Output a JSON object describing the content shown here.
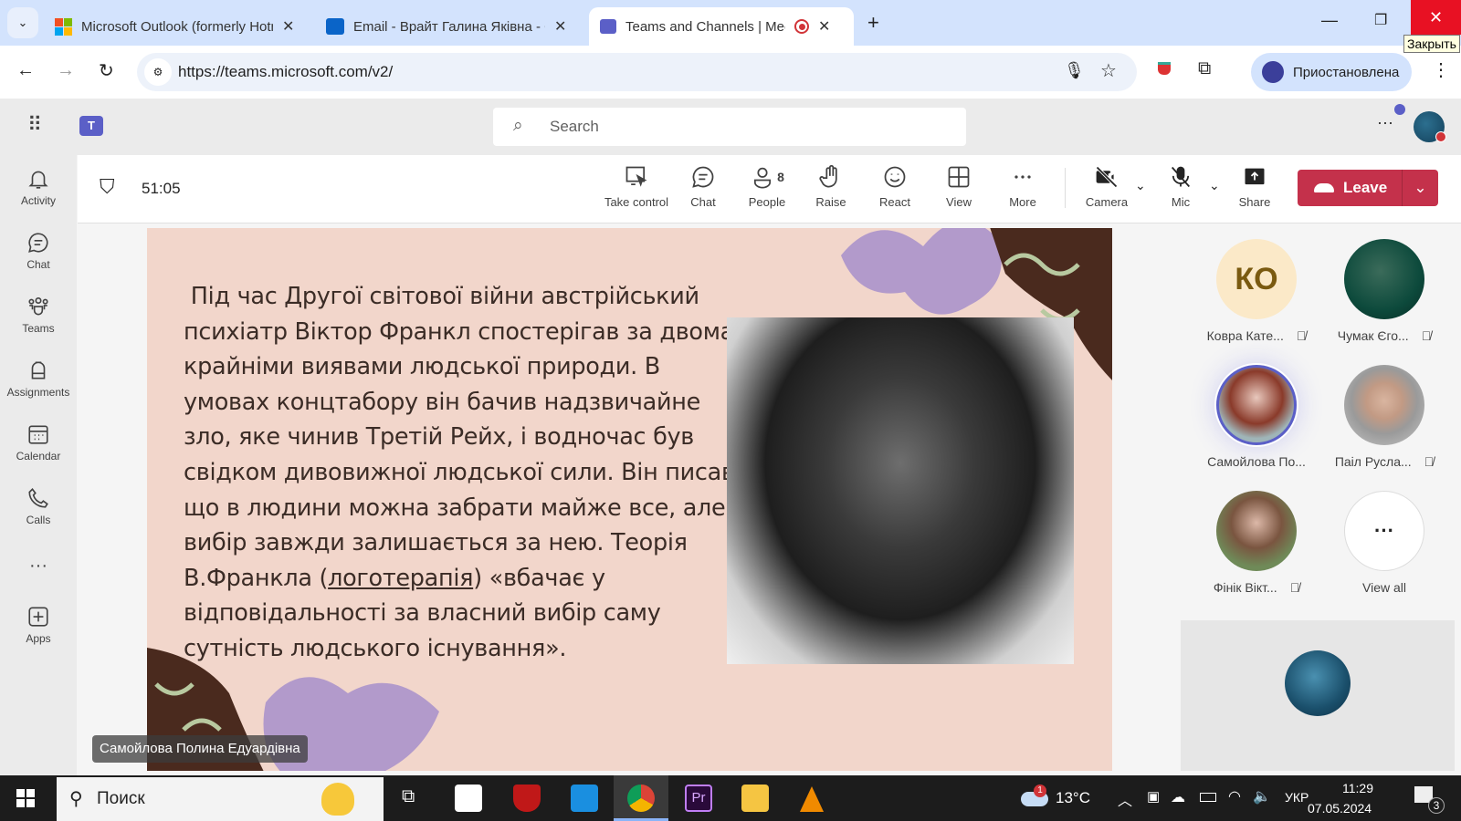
{
  "browser": {
    "tabs": [
      {
        "title": "Microsoft Outlook (formerly Hotmail)",
        "active": false
      },
      {
        "title": "Email - Врайт Галина Яківна - Outlook",
        "active": false
      },
      {
        "title": "Teams and Channels | Meeting",
        "active": true
      }
    ],
    "url": "https://teams.microsoft.com/v2/",
    "profile_label": "Приостановлена",
    "close_tooltip": "Закрыть"
  },
  "teams": {
    "search_placeholder": "Search",
    "rail": [
      {
        "label": "Activity",
        "icon": "bell-icon"
      },
      {
        "label": "Chat",
        "icon": "chat-icon"
      },
      {
        "label": "Teams",
        "icon": "teams-icon"
      },
      {
        "label": "Assignments",
        "icon": "backpack-icon"
      },
      {
        "label": "Calendar",
        "icon": "calendar-icon"
      },
      {
        "label": "Calls",
        "icon": "phone-icon"
      },
      {
        "label": "Apps",
        "icon": "plus-icon"
      }
    ]
  },
  "meeting": {
    "timer": "51:05",
    "people_count": "8",
    "toolbar": {
      "take_control": "Take control",
      "chat": "Chat",
      "people": "People",
      "raise": "Raise",
      "react": "React",
      "view": "View",
      "more": "More",
      "camera": "Camera",
      "mic": "Mic",
      "share": "Share",
      "leave": "Leave"
    },
    "presenter": "Самойлова Полина Едуардівна",
    "slide": {
      "lines": [
        " Під час Другої світової війни австрійський",
        "психіатр Віктор Франкл спостерігав за двома",
        "крайніми виявами людської природи. В",
        "умовах концтабору він бачив надзвичайне",
        "зло, яке чинив Третій Рейх, і водночас був",
        "свідком дивовижної людської сили. Він писав,",
        "що в людини можна забрати майже все, але",
        "вибір завжди залишається за нею. Теорія"
      ],
      "line9_pre": "В.Франкла (",
      "line9_link": "логотерапія",
      "line9_post": ") «вбачає у",
      "lines_end": [
        "відповідальності за власний вибір саму",
        "сутність людського існування»."
      ]
    },
    "participants": [
      {
        "name": "Ковра Кате...",
        "initials": "КО",
        "muted": true
      },
      {
        "name": "Чумак Єго...",
        "muted": true
      },
      {
        "name": "Самойлова По...",
        "muted": false,
        "speaking": true
      },
      {
        "name": "Паіл Русла...",
        "muted": true
      },
      {
        "name": "Фінік Вікт...",
        "muted": true
      }
    ],
    "view_all": "View all"
  },
  "taskbar": {
    "search_placeholder": "Поиск",
    "weather": "13°C",
    "weather_badge": "1",
    "language": "УКР",
    "time": "11:29",
    "date": "07.05.2024",
    "notifications": "3"
  },
  "colors": {
    "accent": "#5b5fc7",
    "leave": "#c4314b",
    "slide_bg": "#f2d6cb"
  }
}
